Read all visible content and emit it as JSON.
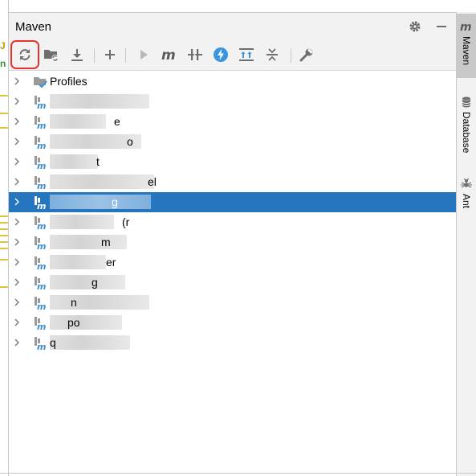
{
  "panel": {
    "title": "Maven"
  },
  "header_buttons": [
    {
      "name": "settings-button",
      "icon": "gear-icon"
    },
    {
      "name": "minimize-button",
      "icon": "minus-icon"
    }
  ],
  "toolbar": {
    "buttons": [
      {
        "name": "reload-all-maven-projects-button",
        "icon": "refresh-icon",
        "highlighted": true
      },
      {
        "name": "generate-sources-button",
        "icon": "folder-refresh-icon"
      },
      {
        "name": "download-sources-button",
        "icon": "download-icon"
      },
      {
        "name": "add-maven-project-button",
        "icon": "plus-icon"
      },
      {
        "name": "run-maven-build-button",
        "icon": "play-icon"
      },
      {
        "name": "execute-maven-goal-button",
        "icon": "maven-m-icon"
      },
      {
        "name": "toggle-skip-tests-button",
        "icon": "skip-tests-icon"
      },
      {
        "name": "offline-mode-button",
        "icon": "lightning-icon"
      },
      {
        "name": "show-dependencies-button",
        "icon": "dependencies-icon"
      },
      {
        "name": "collapse-all-button",
        "icon": "collapse-icon"
      },
      {
        "name": "maven-settings-button",
        "icon": "wrench-icon"
      }
    ]
  },
  "tree": {
    "items": [
      {
        "label": "Profiles",
        "type": "profiles",
        "selected": false
      },
      {
        "label": "",
        "type": "module",
        "selected": false,
        "visible_fragment": ""
      },
      {
        "label": "",
        "type": "module",
        "selected": false,
        "visible_fragment": "e"
      },
      {
        "label": "",
        "type": "module",
        "selected": false,
        "visible_fragment": "o"
      },
      {
        "label": "",
        "type": "module",
        "selected": false,
        "visible_fragment": "t"
      },
      {
        "label": "",
        "type": "module",
        "selected": false,
        "visible_fragment": "el"
      },
      {
        "label": "",
        "type": "module",
        "selected": true,
        "visible_fragment": "g"
      },
      {
        "label": "",
        "type": "module",
        "selected": false,
        "visible_fragment": "(r"
      },
      {
        "label": "",
        "type": "module",
        "selected": false,
        "visible_fragment": "m"
      },
      {
        "label": "",
        "type": "module",
        "selected": false,
        "visible_fragment": "er"
      },
      {
        "label": "",
        "type": "module",
        "selected": false,
        "visible_fragment": "g"
      },
      {
        "label": "",
        "type": "module",
        "selected": false,
        "visible_fragment": "n"
      },
      {
        "label": "",
        "type": "module",
        "selected": false,
        "visible_fragment": "po"
      },
      {
        "label": "",
        "type": "module",
        "selected": false,
        "visible_fragment": "q"
      }
    ]
  },
  "sidebar": {
    "tabs": [
      {
        "label": "Maven",
        "icon": "maven-m-icon",
        "active": true
      },
      {
        "label": "Database",
        "icon": "database-icon",
        "active": false
      },
      {
        "label": "Ant",
        "icon": "ant-icon",
        "active": false
      }
    ]
  },
  "editor_sliver": {
    "marks": [
      "J",
      "n"
    ]
  },
  "colors": {
    "selection": "#2675bf",
    "highlight_border": "#e8332c",
    "panel_bg": "#f2f2f2",
    "maven_icon_blue": "#3d8fd6",
    "profiles_check": "#3d8fd6",
    "lightning_blue": "#3a95e0"
  }
}
